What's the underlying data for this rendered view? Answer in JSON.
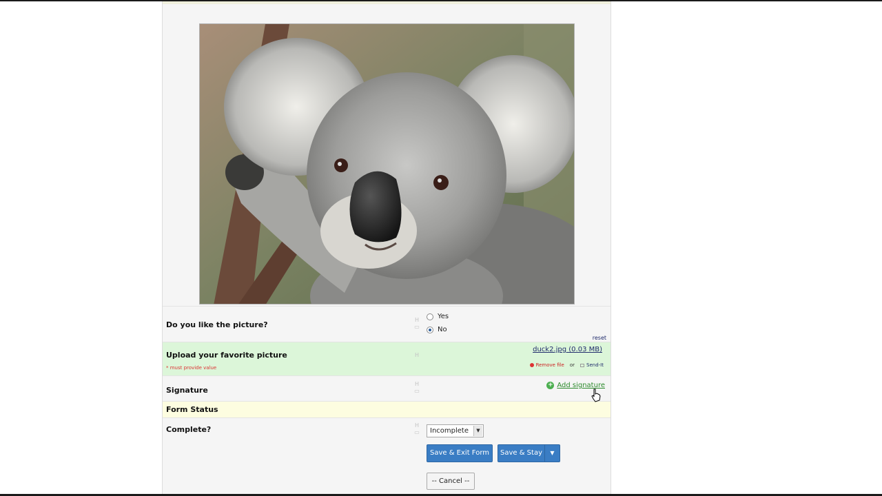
{
  "photo": {
    "subject": "koala-photo"
  },
  "questions": {
    "like_picture": {
      "label": "Do you like the picture?",
      "options": [
        "Yes",
        "No"
      ],
      "selected": "No",
      "reset_label": "reset"
    },
    "upload": {
      "label": "Upload your favorite picture",
      "required_note": "* must provide value",
      "file_link": "duck2.jpg (0.03 MB)",
      "remove_label": "Remove file",
      "or_label": "or",
      "sendit_label": "Send-It"
    },
    "signature": {
      "label": "Signature",
      "add_label": "Add signature"
    }
  },
  "form_status": {
    "header": "Form Status",
    "complete_label": "Complete?",
    "complete_value": "Incomplete"
  },
  "actions": {
    "save_exit": "Save & Exit Form",
    "save_stay": "Save & Stay",
    "cancel": "-- Cancel --"
  },
  "colors": {
    "primary_button": "#3a7dc4",
    "required_row": "#dcf6d9",
    "section_header": "#fdfde0",
    "required_text": "#dd3333",
    "add_link": "#2c8a2c"
  }
}
